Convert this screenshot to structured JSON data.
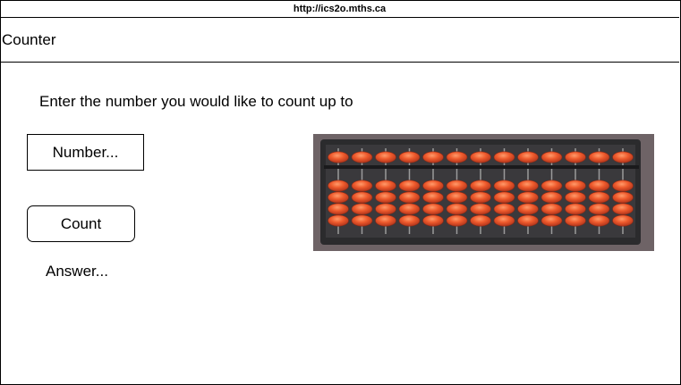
{
  "browser": {
    "url": "http://ics2o.mths.ca"
  },
  "app": {
    "title": "Counter"
  },
  "main": {
    "prompt": "Enter the number you would like to count up to",
    "number_input": {
      "placeholder": "Number...",
      "value": ""
    },
    "count_button": "Count",
    "answer": "Answer..."
  },
  "image": {
    "subject": "abacus",
    "rods": 13,
    "bead_color": "#e8522a",
    "frame_color": "#2b2b2d"
  }
}
